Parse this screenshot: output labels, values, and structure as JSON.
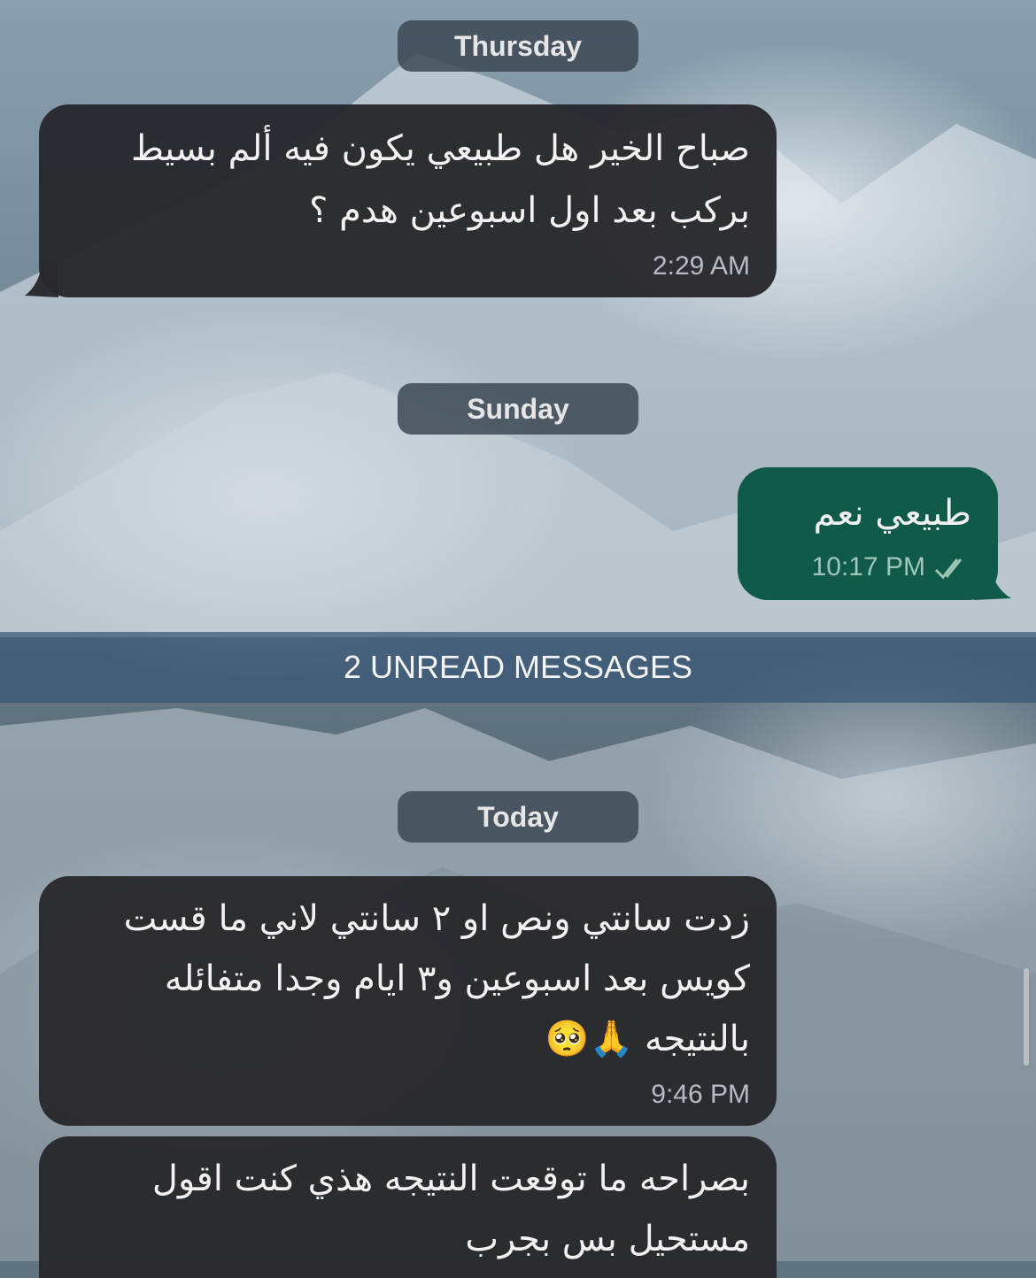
{
  "day_separators": {
    "thursday": "Thursday",
    "sunday": "Sunday",
    "today": "Today"
  },
  "unread_banner": "2 UNREAD MESSAGES",
  "messages": [
    {
      "direction": "incoming",
      "lines": [
        "صباح الخير هل طبيعي يكون فيه ألم بسيط",
        "بركب بعد اول اسبوعين هدم ؟"
      ],
      "time": "2:29 AM"
    },
    {
      "direction": "outgoing",
      "lines": [
        "طبيعي نعم"
      ],
      "time": "10:17 PM",
      "status": "read"
    },
    {
      "direction": "incoming",
      "lines": [
        "زدت سانتي ونص او ٢ سانتي لاني ما قست",
        "كويس بعد اسبوعين و٣ ايام وجدا متفائله",
        "بالنتيجه 🙏🥺"
      ],
      "time": "9:46 PM"
    },
    {
      "direction": "incoming",
      "lines": [
        "بصراحه ما توقعت النتيجه هذي كنت اقول",
        "مستحيل بس بجرب"
      ],
      "time": ""
    }
  ],
  "colors": {
    "incoming_bubble": "#28282c",
    "outgoing_bubble": "#0f5a49",
    "unread_banner": "#385676"
  }
}
